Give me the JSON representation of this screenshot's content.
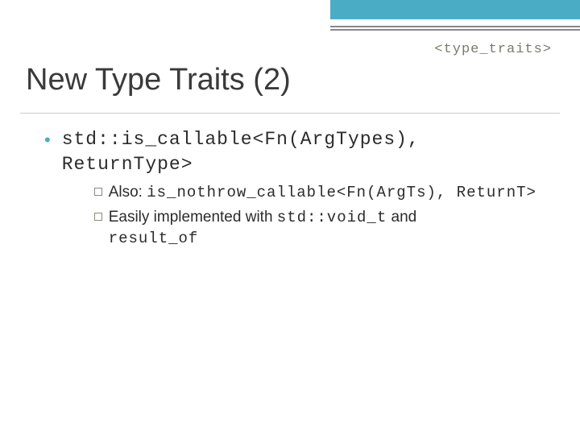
{
  "header": {
    "label": "<type_traits>"
  },
  "title": "New Type Traits (2)",
  "bullet": {
    "code": "std::is_callable<Fn(ArgTypes), ReturnType>"
  },
  "sub1": {
    "prefix": "Also: ",
    "code": "is_nothrow_callable<Fn(ArgTs), ReturnT>"
  },
  "sub2": {
    "part1": "Easily implemented with ",
    "code1": "std::void_t",
    "part2": "  and ",
    "code2": "result_of"
  }
}
